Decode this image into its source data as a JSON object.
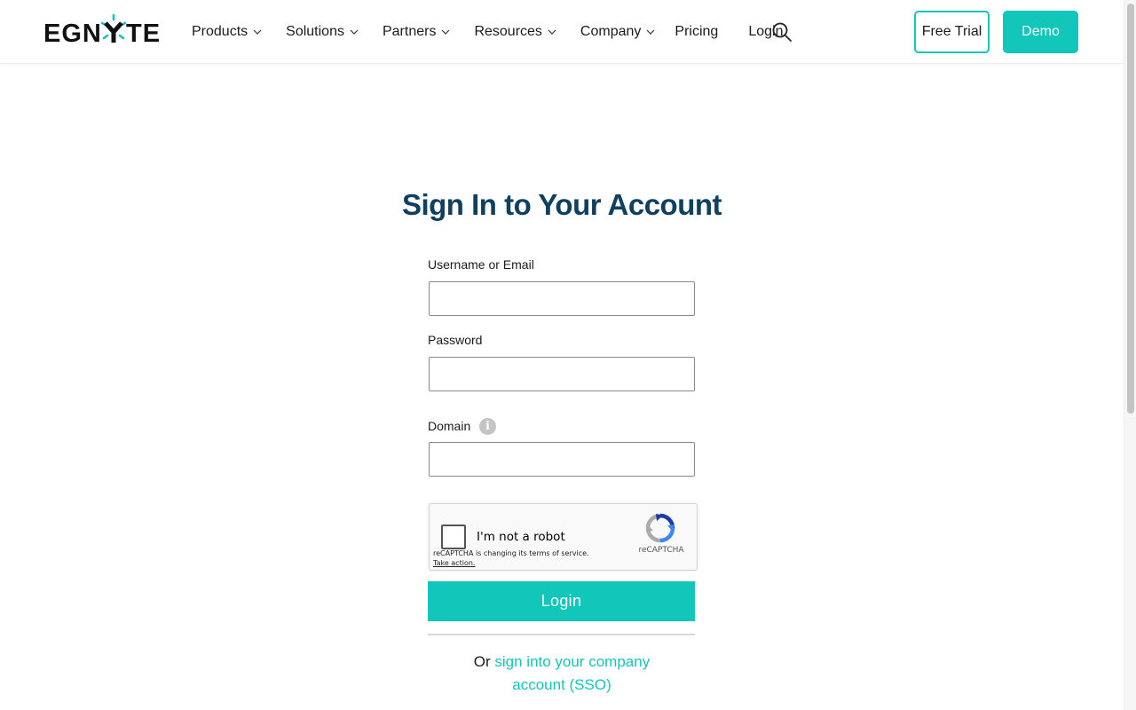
{
  "brand": {
    "logo_text": "EGNYTE",
    "accent_color": "#12c6b9",
    "title_color": "#0f4060"
  },
  "nav": {
    "items": [
      {
        "label": "Products",
        "has_dropdown": true
      },
      {
        "label": "Solutions",
        "has_dropdown": true
      },
      {
        "label": "Partners",
        "has_dropdown": true
      },
      {
        "label": "Resources",
        "has_dropdown": true
      },
      {
        "label": "Company",
        "has_dropdown": true
      },
      {
        "label": "Pricing",
        "has_dropdown": false
      },
      {
        "label": "Login",
        "has_dropdown": false
      }
    ],
    "search_icon": "search-icon",
    "free_trial_label": "Free Trial",
    "demo_label": "Demo"
  },
  "form": {
    "title": "Sign In to Your Account",
    "username_label": "Username or Email",
    "username_value": "",
    "password_label": "Password",
    "password_value": "",
    "domain_label": "Domain",
    "domain_value": "",
    "domain_info_icon": "info-icon",
    "login_label": "Login"
  },
  "captcha": {
    "checkbox_label": "I'm not a robot",
    "notice": "reCAPTCHA is changing its terms of service.",
    "notice_link": "Take action.",
    "brand": "reCAPTCHA"
  },
  "sso": {
    "prefix": "Or",
    "link_text": "sign into your company account (SSO)"
  }
}
